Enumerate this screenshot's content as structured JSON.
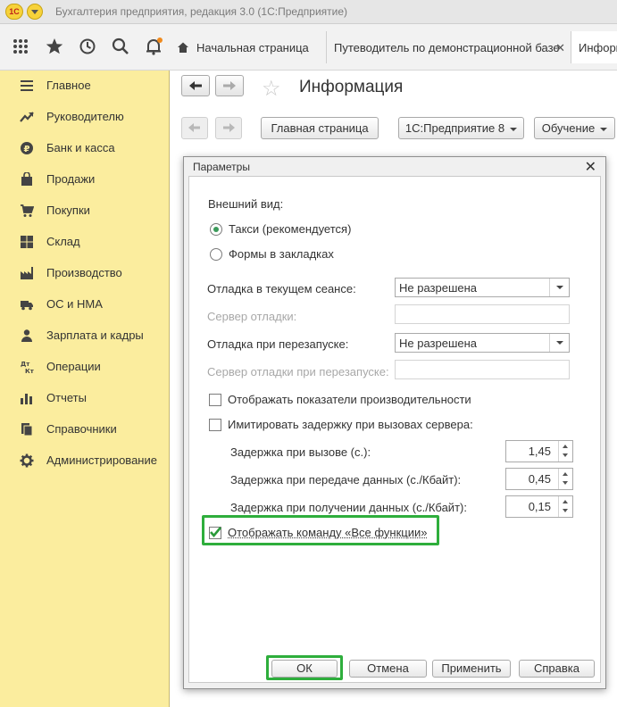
{
  "window": {
    "title": "Бухгалтерия предприятия, редакция 3.0  (1С:Предприятие)",
    "logo_text": "1С"
  },
  "top_panel": {
    "icons": [
      "apps-grid-icon",
      "favorites-star-icon",
      "history-icon",
      "search-icon",
      "notifications-bell-icon"
    ],
    "tabs": [
      {
        "label": "Начальная страница",
        "closable": false
      },
      {
        "label": "Путеводитель по демонстрационной базе",
        "closable": true
      },
      {
        "label": "Информация",
        "closable": false
      }
    ]
  },
  "sidebar": {
    "items": [
      {
        "label": "Главное",
        "icon": "list-icon"
      },
      {
        "label": "Руководителю",
        "icon": "trend-chart-icon"
      },
      {
        "label": "Банк и касса",
        "icon": "ruble-coin-icon"
      },
      {
        "label": "Продажи",
        "icon": "shopping-bag-icon"
      },
      {
        "label": "Покупки",
        "icon": "cart-icon"
      },
      {
        "label": "Склад",
        "icon": "warehouse-icon"
      },
      {
        "label": "Производство",
        "icon": "factory-icon"
      },
      {
        "label": "ОС и НМА",
        "icon": "truck-icon"
      },
      {
        "label": "Зарплата и кадры",
        "icon": "person-icon"
      },
      {
        "label": "Операции",
        "icon": "debit-credit-icon"
      },
      {
        "label": "Отчеты",
        "icon": "bar-chart-icon"
      },
      {
        "label": "Справочники",
        "icon": "books-icon"
      },
      {
        "label": "Администрирование",
        "icon": "gear-icon"
      }
    ]
  },
  "page": {
    "title": "Информация",
    "buttons": {
      "home": "Главная страница",
      "platform": "1С:Предприятие 8",
      "learning": "Обучение"
    }
  },
  "dialog": {
    "title": "Параметры",
    "appearance_label": "Внешний вид:",
    "radio_taxi": "Такси (рекомендуется)",
    "radio_tabs": "Формы в закладках",
    "selected_appearance": "Такси (рекомендуется)",
    "debug_current_label": "Отладка в текущем сеансе:",
    "debug_current_value": "Не разрешена",
    "debug_server_label": "Сервер отладки:",
    "debug_server_value": "",
    "debug_restart_label": "Отладка при перезапуске:",
    "debug_restart_value": "Не разрешена",
    "debug_restart_server_label": "Сервер отладки при перезапуске:",
    "debug_restart_server_value": "",
    "show_perf_label": "Отображать показатели производительности",
    "show_perf_checked": false,
    "simulate_delay_label": "Имитировать задержку при вызовах сервера:",
    "simulate_delay_checked": false,
    "delay_call_label": "Задержка при вызове (с.):",
    "delay_call_value": "1,45",
    "delay_send_label": "Задержка при передаче данных (с./Кбайт):",
    "delay_send_value": "0,45",
    "delay_receive_label": "Задержка при получении данных (с./Кбайт):",
    "delay_receive_value": "0,15",
    "show_all_functions_label": "Отображать команду «Все функции»",
    "show_all_functions_checked": true,
    "buttons": {
      "ok": "ОК",
      "cancel": "Отмена",
      "apply": "Применить",
      "help": "Справка"
    },
    "highlight_color": "#2eae3c"
  },
  "colors": {
    "sidebar_bg": "#fbed9e",
    "accent_green": "#2eae3c",
    "radio_green": "#3a9a5a"
  }
}
